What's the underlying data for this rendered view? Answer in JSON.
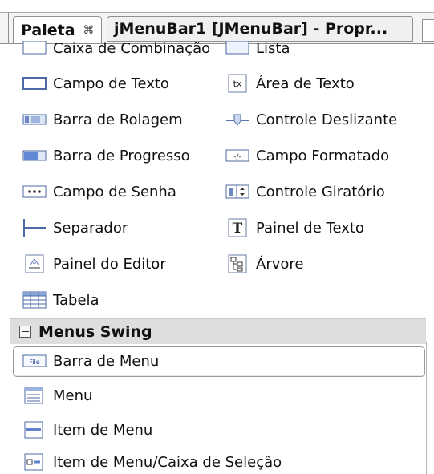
{
  "tabs": {
    "palette": {
      "label": "Paleta",
      "close": "⌘"
    },
    "properties": {
      "label": "jMenuBar1 [JMenuBar] - Propr..."
    }
  },
  "top_cut_left": "Caixa de Combinação",
  "top_cut_right": "Lista",
  "components": [
    {
      "label": "Campo de Texto",
      "icon": "text-field-icon"
    },
    {
      "label": "Área de Texto",
      "icon": "text-area-icon"
    },
    {
      "label": "Barra de Rolagem",
      "icon": "scroll-bar-icon"
    },
    {
      "label": "Controle Deslizante",
      "icon": "slider-icon"
    },
    {
      "label": "Barra de Progresso",
      "icon": "progress-bar-icon"
    },
    {
      "label": "Campo Formatado",
      "icon": "formatted-field-icon"
    },
    {
      "label": "Campo de Senha",
      "icon": "password-field-icon"
    },
    {
      "label": "Controle Giratório",
      "icon": "spinner-icon"
    },
    {
      "label": "Separador",
      "icon": "separator-icon"
    },
    {
      "label": "Painel de Texto",
      "icon": "text-pane-icon"
    },
    {
      "label": "Painel do Editor",
      "icon": "editor-pane-icon"
    },
    {
      "label": "Árvore",
      "icon": "tree-icon"
    },
    {
      "label": "Tabela",
      "icon": "table-icon"
    }
  ],
  "section": {
    "title": "Menus Swing"
  },
  "menu_items": [
    {
      "label": "Barra de Menu",
      "icon": "menu-bar-icon"
    },
    {
      "label": "Menu",
      "icon": "menu-icon"
    },
    {
      "label": "Item de Menu",
      "icon": "menu-item-icon"
    },
    {
      "label": "Item de Menu/Caixa de Seleção",
      "icon": "checkbox-menu-item-icon"
    }
  ],
  "icon_texts": {
    "text_area": "tx",
    "menu_bar": "File",
    "formatted": "-/-",
    "text_pane": "T"
  }
}
